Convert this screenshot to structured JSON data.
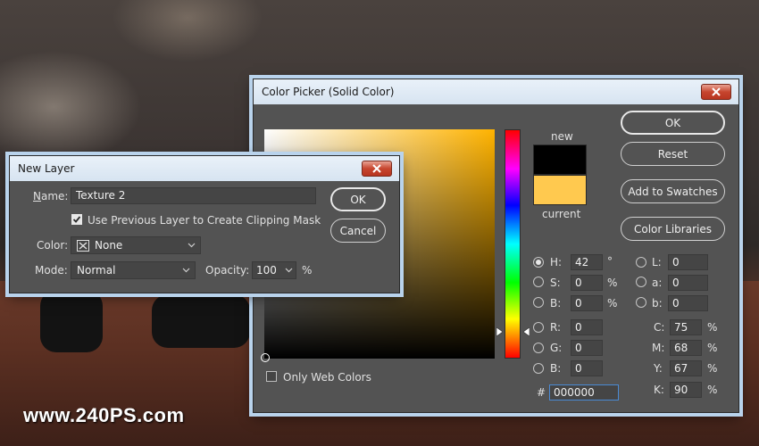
{
  "watermark": "www.240PS.com",
  "new_layer": {
    "title": "New Layer",
    "name_label": "Name:",
    "name_value": "Texture 2",
    "clip_label": "Use Previous Layer to Create Clipping Mask",
    "clip_checked": true,
    "color_label": "Color:",
    "color_value": "None",
    "mode_label": "Mode:",
    "mode_value": "Normal",
    "opacity_label": "Opacity:",
    "opacity_value": "100",
    "opacity_unit": "%",
    "ok_label": "OK",
    "cancel_label": "Cancel"
  },
  "color_picker": {
    "title": "Color Picker (Solid Color)",
    "ok_label": "OK",
    "reset_label": "Reset",
    "add_swatches_label": "Add to Swatches",
    "color_libraries_label": "Color Libraries",
    "new_label": "new",
    "current_label": "current",
    "new_color": "#000000",
    "current_color": "#ffc94f",
    "only_web_colors_label": "Only Web Colors",
    "hsb": [
      {
        "label": "H:",
        "value": "42",
        "unit": "°",
        "checked": true
      },
      {
        "label": "S:",
        "value": "0",
        "unit": "%",
        "checked": false
      },
      {
        "label": "B:",
        "value": "0",
        "unit": "%",
        "checked": false
      }
    ],
    "rgb": [
      {
        "label": "R:",
        "value": "0"
      },
      {
        "label": "G:",
        "value": "0"
      },
      {
        "label": "B:",
        "value": "0"
      }
    ],
    "lab": [
      {
        "label": "L:",
        "value": "0"
      },
      {
        "label": "a:",
        "value": "0"
      },
      {
        "label": "b:",
        "value": "0"
      }
    ],
    "cmyk": [
      {
        "label": "C:",
        "value": "75",
        "unit": "%"
      },
      {
        "label": "M:",
        "value": "68",
        "unit": "%"
      },
      {
        "label": "Y:",
        "value": "67",
        "unit": "%"
      },
      {
        "label": "K:",
        "value": "90",
        "unit": "%"
      }
    ],
    "hex_label": "#",
    "hex_value": "000000"
  },
  "colors": {
    "accent_titlebar": "#d7e4f1",
    "dialog_bg": "#535353",
    "hue_base": "#ffb300"
  }
}
